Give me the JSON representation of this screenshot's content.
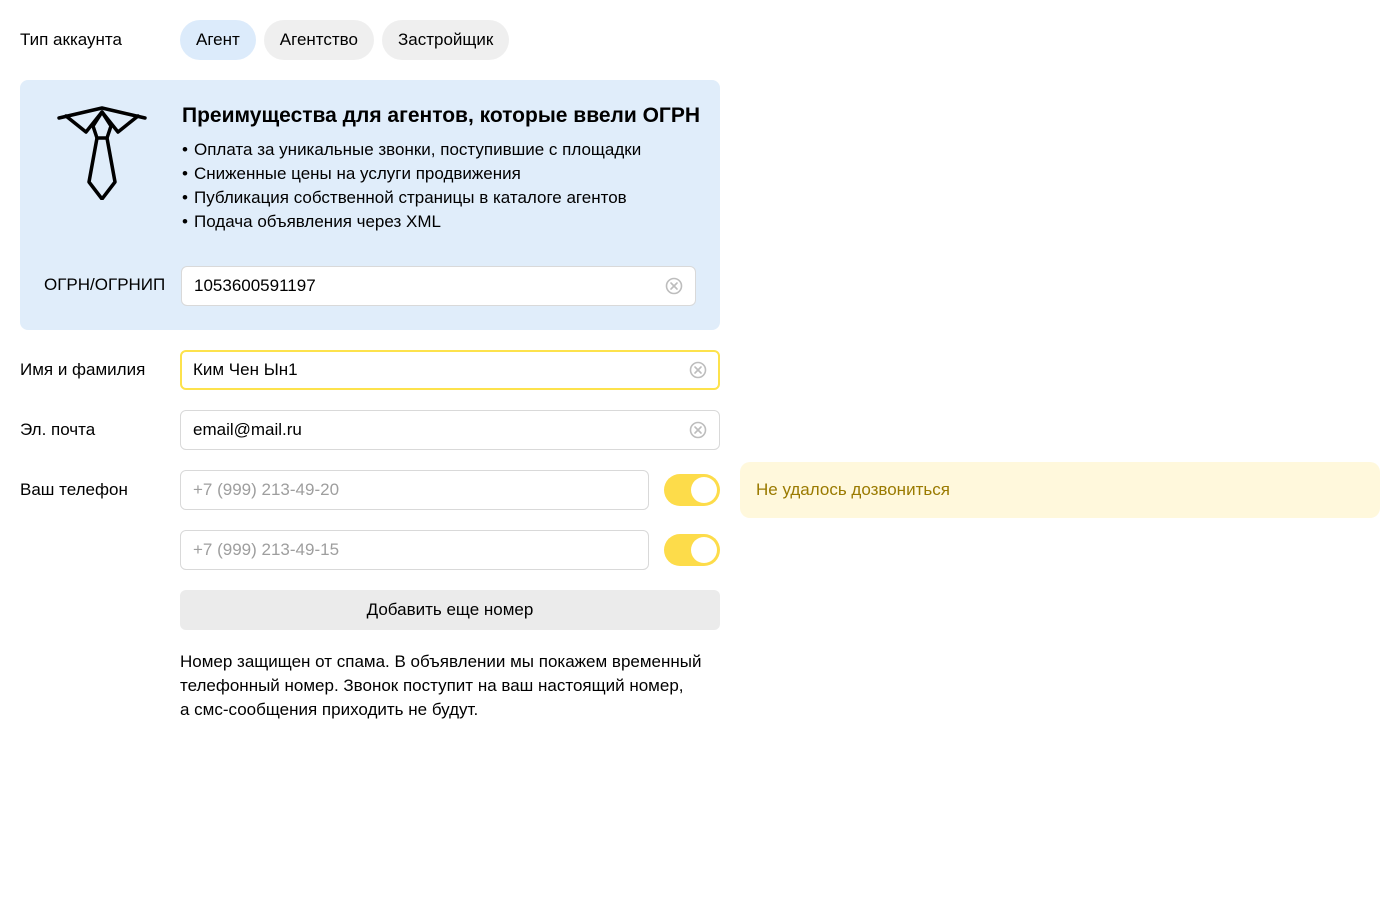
{
  "account_type": {
    "label": "Тип аккаунта",
    "options": [
      "Агент",
      "Агентство",
      "Застройщик"
    ],
    "selected": "Агент"
  },
  "benefits": {
    "icon": "tie-icon",
    "title": "Преимущества для агентов, которые ввели ОГРН",
    "bullet": "•",
    "items": [
      "Оплата за уникальные звонки, поступившие с площадки",
      "Сниженные цены на услуги продвижения",
      "Публикация собственной страницы в каталоге агентов",
      "Подача объявления через XML"
    ],
    "ogrn_label": "ОГРН/ОГРНИП",
    "ogrn_value": "1053600591197"
  },
  "form": {
    "name_label": "Имя и фамилия",
    "name_value": "Ким Чен Ын1",
    "email_label": "Эл. почта",
    "email_value": "email@mail.ru",
    "phone_label": "Ваш телефон",
    "phones": [
      {
        "placeholder": "+7 (999) 213-49-20",
        "enabled": true
      },
      {
        "placeholder": "+7 (999) 213-49-15",
        "enabled": true
      }
    ],
    "call_error": "Не удалось дозвониться",
    "add_phone_label": "Добавить еще номер",
    "spam_note_lines": [
      "Номер защищен от спама. В объявлении мы покажем временный",
      "телефонный номер. Звонок поступит на ваш настоящий номер,",
      "а смс-сообщения приходить не будут."
    ]
  },
  "colors": {
    "panel_bg": "#e0edfa",
    "active_pill": "#dcebfb",
    "toggle_on": "#fddc4a",
    "focus_border": "#fde24c",
    "error_bg": "#fff8dc",
    "error_text": "#9a7a00"
  }
}
